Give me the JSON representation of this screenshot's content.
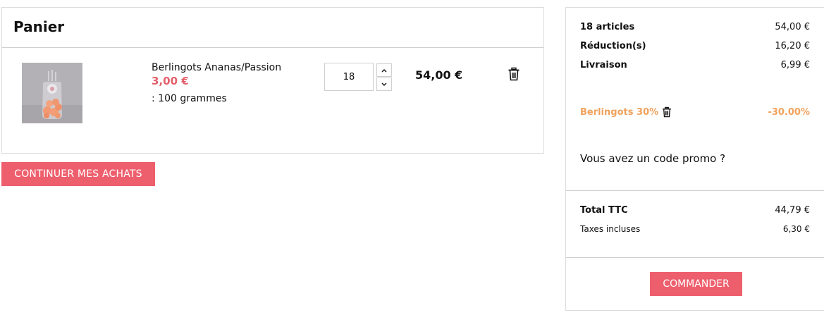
{
  "cart": {
    "title": "Panier",
    "item": {
      "name": "Berlingots Ananas/Passion",
      "unit_price": "3,00 €",
      "attribute": ": 100 grammes",
      "quantity": "18",
      "line_total": "54,00 €",
      "image_icon": "product-photo"
    },
    "icons": {
      "increment": "chevron-up-icon",
      "decrement": "chevron-down-icon",
      "remove": "trash-icon"
    },
    "continue_label": "CONTINUER MES ACHATS"
  },
  "summary": {
    "items_label": "18 articles",
    "items_value": "54,00 €",
    "discount_label": "Réduction(s)",
    "discount_value": "16,20 €",
    "shipping_label": "Livraison",
    "shipping_value": "6,99 €",
    "promo": {
      "name": "Berlingots 30%",
      "value": "-30.00%",
      "color": "#f0a25c"
    },
    "promo_question": "Vous avez un code promo ?",
    "total_label": "Total TTC",
    "total_value": "44,79 €",
    "tax_label": "Taxes incluses",
    "tax_value": "6,30 €",
    "order_label": "COMMANDER"
  },
  "colors": {
    "accent": "#ee5f6d",
    "price": "#e45f6b",
    "promo": "#f0a25c",
    "border": "#dcdcdc"
  }
}
